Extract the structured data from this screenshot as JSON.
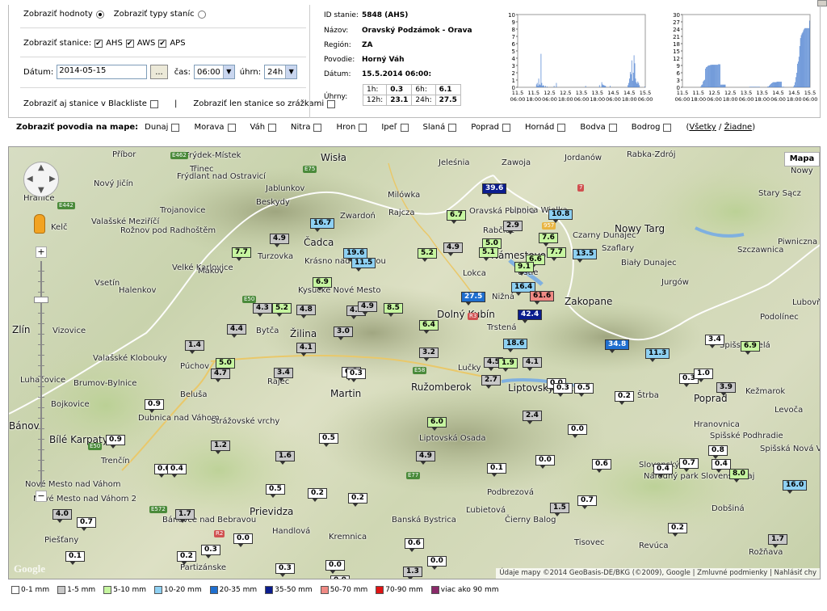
{
  "controls": {
    "show_values_label": "Zobraziť hodnoty",
    "show_types_label": "Zobraziť typy staníc",
    "show_stations_label": "Zobraziť stanice:",
    "station_types": [
      "AHS",
      "AWS",
      "APS"
    ],
    "date_label": "Dátum:",
    "date_value": "2014-05-15",
    "browse_button": "...",
    "time_label": "čas:",
    "time_value": "06:00",
    "total_label": "úhrn:",
    "total_value": "24h",
    "blacklist_label": "Zobraziť aj stanice v Blackliste",
    "separator": "|",
    "precip_only_label": "Zobraziť len stanice so zrážkami"
  },
  "station": {
    "id_label": "ID stanie:",
    "id_value": "5848 (AHS)",
    "name_label": "Názov:",
    "name_value": "Oravský Podzámok - Orava",
    "region_label": "Región:",
    "region_value": "ZA",
    "basin_label": "Povodie:",
    "basin_value": "Horný Váh",
    "date_label": "Dátum:",
    "date_value": "15.5.2014 06:00:",
    "totals_label": "Úhrny:",
    "totals": [
      {
        "k1": "1h:",
        "v1": "0.3",
        "k2": "6h:",
        "v2": "6.1"
      },
      {
        "k1": "12h:",
        "v1": "23.1",
        "k2": "24h:",
        "v2": "27.5"
      }
    ]
  },
  "chart_data": [
    {
      "type": "bar",
      "x_ticks": [
        "11.5\n06:00",
        "11.5\n18:00",
        "12.5\n06:00",
        "12.5\n18:00",
        "13.5\n06:00",
        "13.5\n18:00",
        "14.5\n06:00",
        "14.5\n18:00",
        "15.5\n06:00"
      ],
      "ylim": [
        0,
        10
      ],
      "y_ticks": [
        0,
        1,
        2,
        3,
        4,
        5,
        6,
        7,
        8,
        9,
        10
      ],
      "values": [
        0,
        0,
        0,
        0,
        0,
        0,
        0,
        0,
        0,
        0,
        0,
        0,
        0,
        0,
        0,
        0,
        0,
        0,
        0,
        0,
        0,
        0,
        0,
        0,
        0.4,
        0.6,
        0.2,
        1.2,
        0.4,
        0.3,
        4.6,
        0.6,
        0.2,
        0.3,
        0.2,
        0,
        0.2,
        0,
        0.1,
        0,
        0,
        0,
        0,
        0,
        0,
        0,
        0,
        0.2,
        0,
        0,
        0.6,
        0,
        0,
        0,
        0,
        0,
        0,
        0,
        0,
        0,
        0,
        0,
        0,
        0,
        0,
        0,
        0,
        0,
        0,
        0,
        0,
        0,
        0,
        0,
        0,
        0,
        0,
        0,
        0,
        0,
        0,
        0,
        0,
        0,
        0,
        0,
        0,
        0,
        0.2,
        0,
        0,
        0,
        0,
        0,
        0,
        0,
        0,
        0,
        0,
        0,
        0,
        0,
        0,
        0,
        0,
        0,
        0.3,
        0,
        0,
        0.7,
        0.4,
        0.3,
        0.3,
        0.2,
        0.2,
        0,
        0,
        0,
        0,
        0,
        0.2,
        0,
        0,
        0,
        0,
        0,
        0,
        0,
        0,
        0,
        0,
        0,
        0,
        0,
        0,
        0,
        0,
        0,
        0,
        0,
        0,
        0,
        0,
        0.3,
        0.6,
        1.2,
        2.1,
        1.8,
        3.7,
        0.9,
        2.0,
        4.4,
        3.3,
        1.2,
        0.7,
        0.5,
        0.8,
        0.6,
        0.3,
        0,
        0,
        0,
        0,
        0,
        0,
        0.1
      ]
    },
    {
      "type": "bar",
      "x_ticks": [
        "11.5\n06:00",
        "11.5\n18:00",
        "12.5\n06:00",
        "12.5\n18:00",
        "13.5\n06:00",
        "13.5\n18:00",
        "14.5\n06:00",
        "14.5\n18:00",
        "15.5\n06:00"
      ],
      "ylim": [
        0,
        30
      ],
      "y_ticks": [
        0,
        3,
        6,
        9,
        12,
        15,
        18,
        21,
        24,
        27,
        30
      ],
      "values": [
        0,
        0,
        0,
        0,
        0,
        0,
        0,
        0,
        0,
        0,
        0,
        0,
        0,
        0,
        0,
        0,
        0,
        0,
        0,
        0,
        0,
        0,
        0,
        0,
        0.4,
        1,
        1.2,
        2.4,
        2.8,
        3.1,
        7.7,
        8.3,
        8.5,
        8.8,
        9,
        9,
        9.2,
        9.2,
        9.3,
        9.3,
        9.3,
        9.3,
        9.3,
        9.3,
        9.3,
        9.3,
        9.3,
        9.5,
        9.5,
        9.5,
        1.1,
        1.1,
        1.1,
        1.1,
        1.1,
        1.1,
        1.1,
        0,
        0,
        0,
        0,
        0,
        0,
        0,
        0,
        0,
        0,
        0,
        0,
        0,
        0,
        0,
        0,
        0,
        0,
        0,
        0,
        0,
        0,
        0,
        0,
        0,
        0,
        0,
        0,
        0,
        0,
        0,
        0.2,
        0.2,
        0.2,
        0.2,
        0.2,
        0.2,
        0.2,
        0.2,
        0.2,
        0.2,
        0.2,
        0.2,
        0.2,
        0.2,
        0,
        0,
        0,
        0,
        0,
        0,
        0,
        0,
        0,
        0,
        0.3,
        0.3,
        0.7,
        1.1,
        1.4,
        1.7,
        1.9,
        2.1,
        2.1,
        2.1,
        2.1,
        2.1,
        2.3,
        2.3,
        2.3,
        2.3,
        2.3,
        2.3,
        2.3,
        0.2,
        0.2,
        0.2,
        0,
        0,
        0,
        0,
        0,
        0,
        0,
        0,
        0,
        0,
        0,
        0,
        0.3,
        0.9,
        2.1,
        4.2,
        6,
        9.7,
        10.6,
        12.6,
        17,
        20.3,
        21.5,
        22.2,
        22.7,
        23.5,
        24.1,
        24.4,
        24.4,
        24.4,
        24.4,
        24.4,
        24.4,
        27.5
      ]
    }
  ],
  "basins": {
    "title": "Zobraziť povodia na mape:",
    "items": [
      "Dunaj",
      "Morava",
      "Váh",
      "Nitra",
      "Hron",
      "Ipeľ",
      "Slaná",
      "Poprad",
      "Hornád",
      "Bodva",
      "Bodrog"
    ],
    "all_label": "Všetky",
    "sep": "/",
    "none_label": "Žiadne"
  },
  "map": {
    "type_button": "Mapa",
    "attribution": "Údaje mapy ©2014 GeoBasis-DE/BKG (©2009), Google",
    "terms": "Zmluvné podmienky",
    "report": "Nahlásiť chy",
    "logo": "Google",
    "towns": [
      {
        "t": "Příbor"
      },
      {
        "t": "Frýdek-Místek"
      },
      {
        "t": "Třinec"
      },
      {
        "t": "Wisła"
      },
      {
        "t": "Jeleśnia"
      },
      {
        "t": "Zawoja"
      },
      {
        "t": "Jordanów"
      },
      {
        "t": "Rabka-Zdrój"
      },
      {
        "t": "Nový Jičín"
      },
      {
        "t": "Frýdlant nad Ostravicí"
      },
      {
        "t": "Jablunkov"
      },
      {
        "t": "Milówka"
      },
      {
        "t": "Hranice"
      },
      {
        "t": "Trojanovice"
      },
      {
        "t": "Beskydy"
      },
      {
        "t": "Zwardoń"
      },
      {
        "t": "Rajcza"
      },
      {
        "t": "Oravská Polhora"
      },
      {
        "t": "Lipnica Wielka"
      },
      {
        "t": "Nowy Targ"
      },
      {
        "t": "Stary Sącz"
      },
      {
        "t": "Nowy"
      },
      {
        "t": "Kelč"
      },
      {
        "t": "Valašské Meziříčí"
      },
      {
        "t": "Rožnov pod Radhoštěm"
      },
      {
        "t": "Čadca"
      },
      {
        "t": "Rabčice"
      },
      {
        "t": "Czarny Dunajec"
      },
      {
        "t": "Szaflary"
      },
      {
        "t": "Piwniczna"
      },
      {
        "t": "Szczawnica"
      },
      {
        "t": "Velké Karlovice"
      },
      {
        "t": "Makov"
      },
      {
        "t": "Turzovka"
      },
      {
        "t": "Krásno nad Kysucou"
      },
      {
        "t": "Námestovo"
      },
      {
        "t": "Lokca"
      },
      {
        "t": "Ústie"
      },
      {
        "t": "Biały Dunajec"
      },
      {
        "t": "Jurgów"
      },
      {
        "t": "Lubovňa"
      },
      {
        "t": "Vsetín"
      },
      {
        "t": "Halenkov"
      },
      {
        "t": "Kysucké Nové Mesto"
      },
      {
        "t": "Nižná"
      },
      {
        "t": "Zakopane"
      },
      {
        "t": "Podolínec"
      },
      {
        "t": "Zlín"
      },
      {
        "t": "Vizovice"
      },
      {
        "t": "Žilina"
      },
      {
        "t": "Bytča"
      },
      {
        "t": "Dolný Kubín"
      },
      {
        "t": "Trstená"
      },
      {
        "t": "Spišská Belá"
      },
      {
        "t": "Valašské Klobouky"
      },
      {
        "t": "Púchov"
      },
      {
        "t": "Rajec"
      },
      {
        "t": "Martin"
      },
      {
        "t": "Ružomberok"
      },
      {
        "t": "Liptovský Mikuláš"
      },
      {
        "t": "Lučky"
      },
      {
        "t": "Poprad"
      },
      {
        "t": "Štrba"
      },
      {
        "t": "Luhačovice"
      },
      {
        "t": "Brumov-Bylnice"
      },
      {
        "t": "Beluša"
      },
      {
        "t": "Kežmarok"
      },
      {
        "t": "Levoča"
      },
      {
        "t": "Bojkovice"
      },
      {
        "t": "Dubnica nad Váhom"
      },
      {
        "t": "Strážovské vrchy"
      },
      {
        "t": "Liptovská Osada"
      },
      {
        "t": "Hranovnica"
      },
      {
        "t": "Spišské Podhradie"
      },
      {
        "t": "Bánov"
      },
      {
        "t": "Bílé Karpaty"
      },
      {
        "t": "Trenčín"
      },
      {
        "t": "Spišská Nová Ves"
      },
      {
        "t": "Nové Mesto nad Váhom"
      },
      {
        "t": "Prievidza"
      },
      {
        "t": "Banská Bystrica"
      },
      {
        "t": "Podbrezová"
      },
      {
        "t": "Ľubietová"
      },
      {
        "t": "Čierny Balog"
      },
      {
        "t": "Dobšiná"
      },
      {
        "t": "Nové Mesto nad Váhom 2"
      },
      {
        "t": "Bánovce nad Bebravou"
      },
      {
        "t": "Handlová"
      },
      {
        "t": "Kremnica"
      },
      {
        "t": "Tisovec"
      },
      {
        "t": "Revúca"
      },
      {
        "t": "Rožňava"
      },
      {
        "t": "Piešťany"
      },
      {
        "t": "Partizánske"
      },
      {
        "t": "Slovenský raj"
      },
      {
        "t": "Národný park Slovenský raj"
      }
    ],
    "markers": [
      {
        "v": "39.6",
        "c": "c5"
      },
      {
        "v": "10.8",
        "c": "c3"
      },
      {
        "v": "16.7",
        "c": "c3"
      },
      {
        "v": "6.7",
        "c": "c2"
      },
      {
        "v": "2.9",
        "c": "c1"
      },
      {
        "v": "4.9",
        "c": "c1"
      },
      {
        "v": "7.6",
        "c": "c2"
      },
      {
        "v": "7.7",
        "c": "c2"
      },
      {
        "v": "19.6",
        "c": "c3"
      },
      {
        "v": "11.5",
        "c": "c3"
      },
      {
        "v": "5.2",
        "c": "c2"
      },
      {
        "v": "4.9",
        "c": "c1"
      },
      {
        "v": "5.0",
        "c": "c2"
      },
      {
        "v": "5.1",
        "c": "c2"
      },
      {
        "v": "6.6",
        "c": "c2"
      },
      {
        "v": "7.7",
        "c": "c2"
      },
      {
        "v": "13.5",
        "c": "c3"
      },
      {
        "v": "9.1",
        "c": "c2"
      },
      {
        "v": "6.9",
        "c": "c2"
      },
      {
        "v": "16.4",
        "c": "c3"
      },
      {
        "v": "61.6",
        "c": "c6"
      },
      {
        "v": "27.5",
        "c": "c4"
      },
      {
        "v": "4.3",
        "c": "c1"
      },
      {
        "v": "5.2",
        "c": "c2"
      },
      {
        "v": "4.8",
        "c": "c1"
      },
      {
        "v": "4.2",
        "c": "c1"
      },
      {
        "v": "4.9",
        "c": "c1"
      },
      {
        "v": "8.5",
        "c": "c2"
      },
      {
        "v": "42.4",
        "c": "c5"
      },
      {
        "v": "4.4",
        "c": "c1"
      },
      {
        "v": "3.0",
        "c": "c1"
      },
      {
        "v": "6.4",
        "c": "c2"
      },
      {
        "v": "1.4",
        "c": "c1"
      },
      {
        "v": "4.1",
        "c": "c1"
      },
      {
        "v": "3.2",
        "c": "c1"
      },
      {
        "v": "18.6",
        "c": "c3"
      },
      {
        "v": "34.8",
        "c": "c4"
      },
      {
        "v": "11.3",
        "c": "c3"
      },
      {
        "v": "3.4",
        "c": "c0"
      },
      {
        "v": "6.9",
        "c": "c2"
      },
      {
        "v": "5.0",
        "c": "c2"
      },
      {
        "v": "4.7",
        "c": "c1"
      },
      {
        "v": "3.4",
        "c": "c1"
      },
      {
        "v": "0.3",
        "c": "c0"
      },
      {
        "v": "0.3",
        "c": "c0"
      },
      {
        "v": "4.5",
        "c": "c1"
      },
      {
        "v": "1.9",
        "c": "c2"
      },
      {
        "v": "4.1",
        "c": "c1"
      },
      {
        "v": "2.7",
        "c": "c1"
      },
      {
        "v": "0.0",
        "c": "c0"
      },
      {
        "v": "0.3",
        "c": "c0"
      },
      {
        "v": "0.5",
        "c": "c0"
      },
      {
        "v": "0.3",
        "c": "c0"
      },
      {
        "v": "1.0",
        "c": "c0"
      },
      {
        "v": "3.9",
        "c": "c1"
      },
      {
        "v": "0.2",
        "c": "c0"
      },
      {
        "v": "0.9",
        "c": "c0"
      },
      {
        "v": "2.4",
        "c": "c1"
      },
      {
        "v": "6.0",
        "c": "c2"
      },
      {
        "v": "0.0",
        "c": "c0"
      },
      {
        "v": "0.9",
        "c": "c0"
      },
      {
        "v": "0.5",
        "c": "c0"
      },
      {
        "v": "1.2",
        "c": "c1"
      },
      {
        "v": "1.6",
        "c": "c1"
      },
      {
        "v": "4.9",
        "c": "c1"
      },
      {
        "v": "0.1",
        "c": "c0"
      },
      {
        "v": "0.0",
        "c": "c0"
      },
      {
        "v": "0.6",
        "c": "c0"
      },
      {
        "v": "0.4",
        "c": "c0"
      },
      {
        "v": "0.7",
        "c": "c0"
      },
      {
        "v": "0.8",
        "c": "c0"
      },
      {
        "v": "0.4",
        "c": "c0"
      },
      {
        "v": "8.0",
        "c": "c2"
      },
      {
        "v": "16.0",
        "c": "c3"
      },
      {
        "v": "0.0",
        "c": "c0"
      },
      {
        "v": "0.4",
        "c": "c0"
      },
      {
        "v": "0.5",
        "c": "c0"
      },
      {
        "v": "0.2",
        "c": "c0"
      },
      {
        "v": "0.2",
        "c": "c0"
      },
      {
        "v": "4.0",
        "c": "c1"
      },
      {
        "v": "0.7",
        "c": "c0"
      },
      {
        "v": "1.7",
        "c": "c1"
      },
      {
        "v": "1.5",
        "c": "c1"
      },
      {
        "v": "0.7",
        "c": "c0"
      },
      {
        "v": "0.2",
        "c": "c0"
      },
      {
        "v": "0.0",
        "c": "c0"
      },
      {
        "v": "0.6",
        "c": "c0"
      },
      {
        "v": "1.7",
        "c": "c1"
      },
      {
        "v": "0.3",
        "c": "c0"
      },
      {
        "v": "0.1",
        "c": "c0"
      },
      {
        "v": "0.2",
        "c": "c0"
      },
      {
        "v": "0.0",
        "c": "c0"
      },
      {
        "v": "0.3",
        "c": "c0"
      },
      {
        "v": "1.3",
        "c": "c1"
      },
      {
        "v": "0.0",
        "c": "c0"
      },
      {
        "v": "0.0",
        "c": "c0"
      }
    ],
    "road_badges": [
      "E462",
      "E75",
      "E442",
      "E50",
      "E58",
      "E77",
      "E572",
      "E50",
      "R3",
      "957",
      "7",
      "R2"
    ]
  },
  "legend": [
    {
      "label": "0-1 mm",
      "color": "#ffffff"
    },
    {
      "label": "1-5 mm",
      "color": "#c8c8c8"
    },
    {
      "label": "5-10 mm",
      "color": "#c6f5a0"
    },
    {
      "label": "10-20 mm",
      "color": "#8ed0f2"
    },
    {
      "label": "20-35 mm",
      "color": "#1f6fcf"
    },
    {
      "label": "35-50 mm",
      "color": "#0b1d8e"
    },
    {
      "label": "50-70 mm",
      "color": "#f08a84"
    },
    {
      "label": "70-90 mm",
      "color": "#e01414"
    },
    {
      "label": "viac ako 90 mm",
      "color": "#8a2a6a"
    }
  ]
}
